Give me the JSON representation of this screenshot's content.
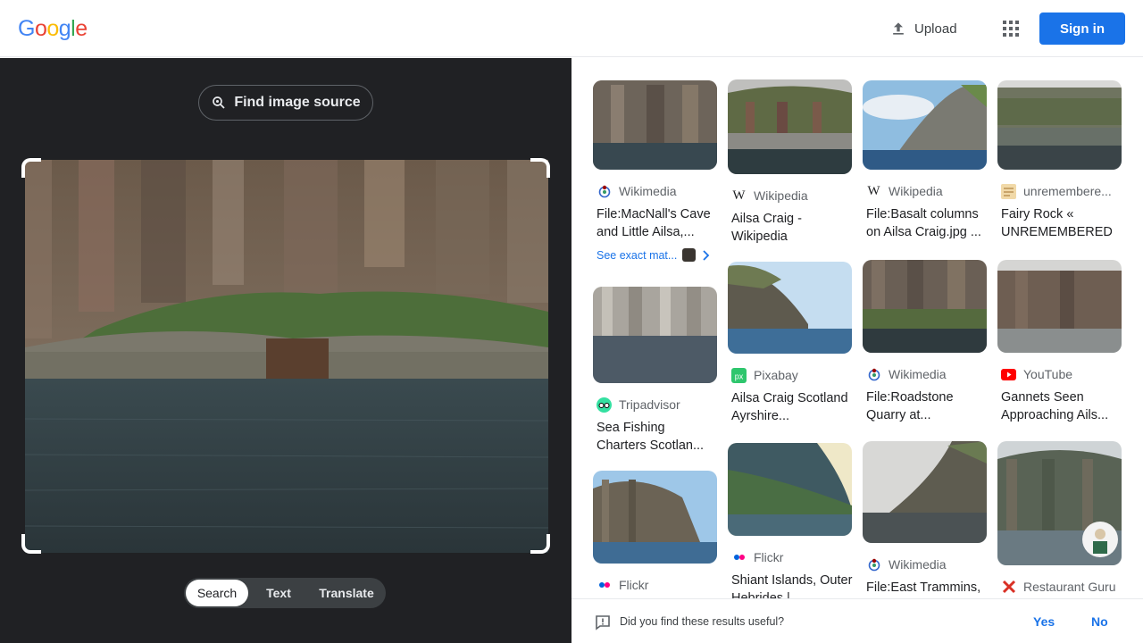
{
  "header": {
    "logo_letters": [
      "G",
      "o",
      "o",
      "g",
      "l",
      "e"
    ],
    "logo_colors": [
      "#4285f4",
      "#ea4335",
      "#fbbc05",
      "#4285f4",
      "#34a853",
      "#ea4335"
    ],
    "upload_label": "Upload",
    "signin_label": "Sign in"
  },
  "left": {
    "find_source_label": "Find image source",
    "tabs": [
      {
        "label": "Search",
        "active": true
      },
      {
        "label": "Text",
        "active": false
      },
      {
        "label": "Translate",
        "active": false
      }
    ]
  },
  "results": [
    {
      "source": "Wikimedia",
      "favicon": "wikimedia-icon",
      "title": "File:MacNall's Cave and Little Ailsa,...",
      "exact_match": "See exact mat..."
    },
    {
      "source": "Wikipedia",
      "favicon": "wikipedia-icon",
      "title": "Ailsa Craig - Wikipedia"
    },
    {
      "source": "Wikipedia",
      "favicon": "wikipedia-icon",
      "title": "File:Basalt columns on Ailsa Craig.jpg ..."
    },
    {
      "source": "unremembere...",
      "favicon": "blog-icon",
      "title": "Fairy Rock « UNREMEMBERED"
    },
    {
      "source": "Tripadvisor",
      "favicon": "tripadvisor-icon",
      "title": "Sea Fishing Charters Scotlan..."
    },
    {
      "source": "Pixabay",
      "favicon": "pixabay-icon",
      "title": "Ailsa Craig Scotland Ayrshire..."
    },
    {
      "source": "Wikimedia",
      "favicon": "wikimedia-icon",
      "title": "File:Roadstone Quarry at..."
    },
    {
      "source": "YouTube",
      "favicon": "youtube-icon",
      "title": "Gannets Seen Approaching Ails..."
    },
    {
      "source": "Flickr",
      "favicon": "flickr-icon",
      "title": ""
    },
    {
      "source": "Flickr",
      "favicon": "flickr-icon",
      "title": "Shiant Islands, Outer Hebrides |..."
    },
    {
      "source": "Wikimedia",
      "favicon": "wikimedia-icon",
      "title": "File:East Trammins, Ri..."
    },
    {
      "source": "Restaurant Guru",
      "favicon": "restaurant-guru-icon",
      "title": ""
    }
  ],
  "feedback": {
    "question": "Did you find these results useful?",
    "yes_label": "Yes",
    "no_label": "No"
  }
}
